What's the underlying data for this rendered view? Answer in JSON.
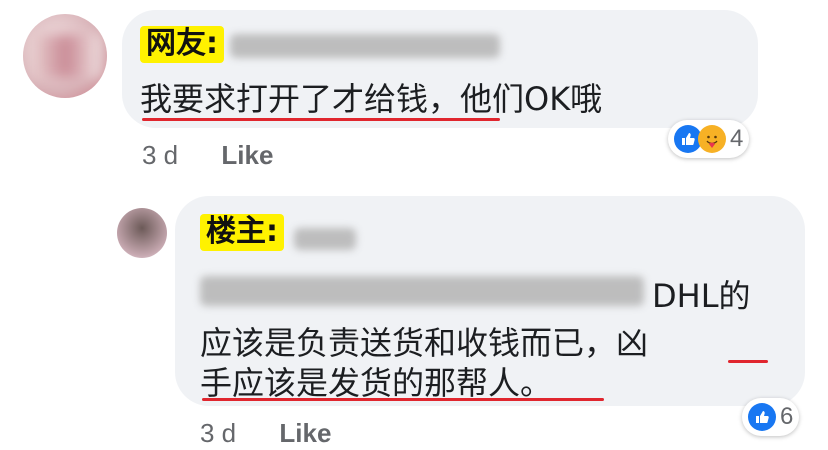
{
  "comment1": {
    "label": "网友:",
    "text": "我要求打开了才给钱，他们OK哦",
    "time": "3 d",
    "like_label": "Like",
    "reaction_count": "4",
    "reaction_icons": [
      "like-icon",
      "care-icon"
    ]
  },
  "comment2": {
    "label": "楼主:",
    "line1_suffix": "DHL的",
    "line2": "应该是负责送货和收钱而已，凶",
    "line3": "手应该是发货的那帮人。",
    "time": "3 d",
    "like_label": "Like",
    "reaction_count": "6",
    "reaction_icons": [
      "like-icon"
    ]
  },
  "colors": {
    "bubble": "#f0f2f5",
    "badge": "#fff200",
    "underline": "#e0262e",
    "like_blue": "#1877f2",
    "meta": "#65676b"
  }
}
